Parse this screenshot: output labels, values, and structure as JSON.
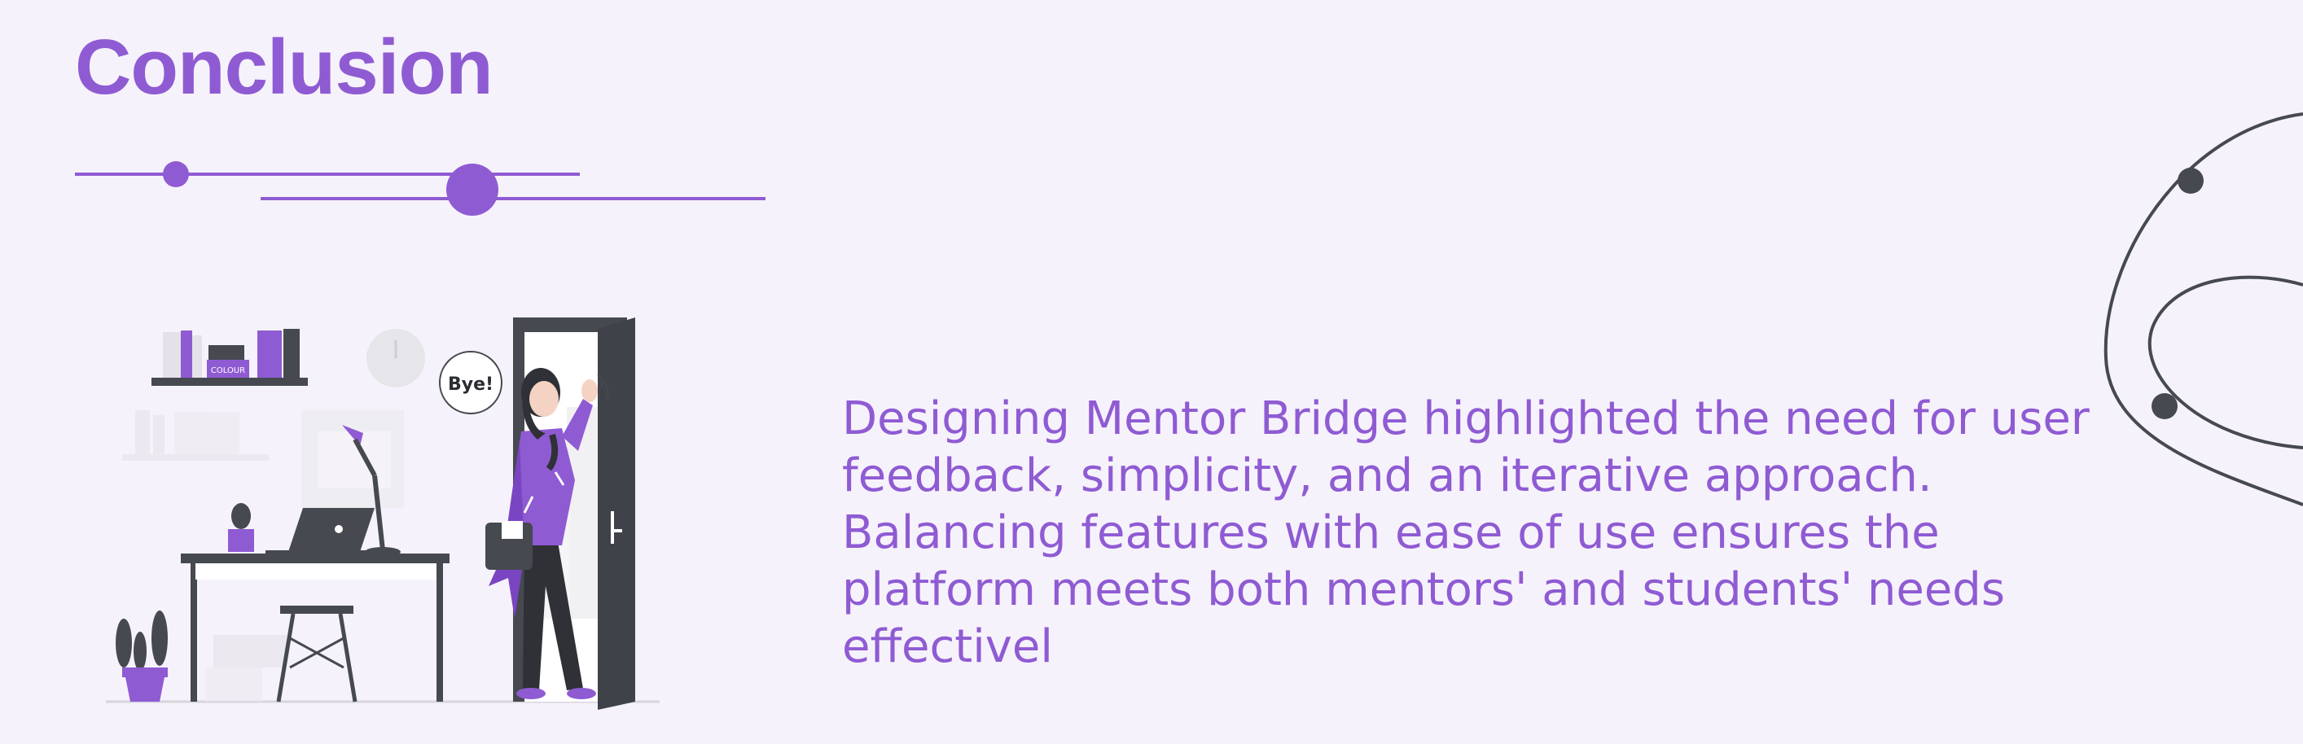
{
  "slide": {
    "title": "Conclusion",
    "body": "Designing Mentor Bridge highlighted the need for user feedback, simplicity, and an iterative approach. Balancing features with ease of use ensures the platform meets both mentors' and students' needs effectivel",
    "illustration": {
      "speech_bubble": "Bye!",
      "book_label": "COLOUR"
    }
  },
  "colors": {
    "accent": "#8f5bd3",
    "background": "#f6f2fb",
    "dark": "#46494f"
  }
}
